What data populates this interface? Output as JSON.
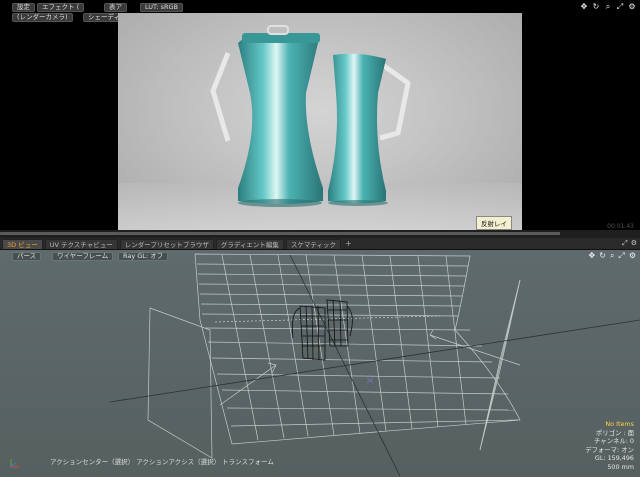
{
  "preview": {
    "buttons": [
      "設定",
      "エフェクト (",
      "表ア",
      "LUT: sRGB"
    ],
    "buttons_row2": [
      "(レンダーカメラ)",
      "シェーディング"
    ],
    "icons": [
      "move-icon",
      "rotate-icon",
      "zoom-icon",
      "fit-icon",
      "gear-icon"
    ],
    "reflect_label": "反射レイ",
    "timecode": "00:01.43"
  },
  "tabs": [
    {
      "label": "3D ビュー",
      "active": true
    },
    {
      "label": "UV テクスチャビュー",
      "active": false
    },
    {
      "label": "レンダープリセットブラウザ",
      "active": false
    },
    {
      "label": "グラディエント編集",
      "active": false
    },
    {
      "label": "スケマティック",
      "active": false
    }
  ],
  "tab_plus": "+",
  "viewport": {
    "buttons": [
      "パース",
      "ワイヤーフレーム",
      "Ray GL: オフ"
    ],
    "status": "アクションセンター（選択）  アクションアクシス（選択）  トランスフォーム",
    "hud": {
      "line1": "No Items",
      "line2": "ポリゴン : 面",
      "line3": "チャンネル: 0",
      "line4": "デフォーマ: オン",
      "line5": "GL: 159,496",
      "line6": "500 mm"
    }
  },
  "colors": {
    "accent": "#f0a030",
    "teal": "#3fa7a8",
    "background": "#5c6668"
  }
}
